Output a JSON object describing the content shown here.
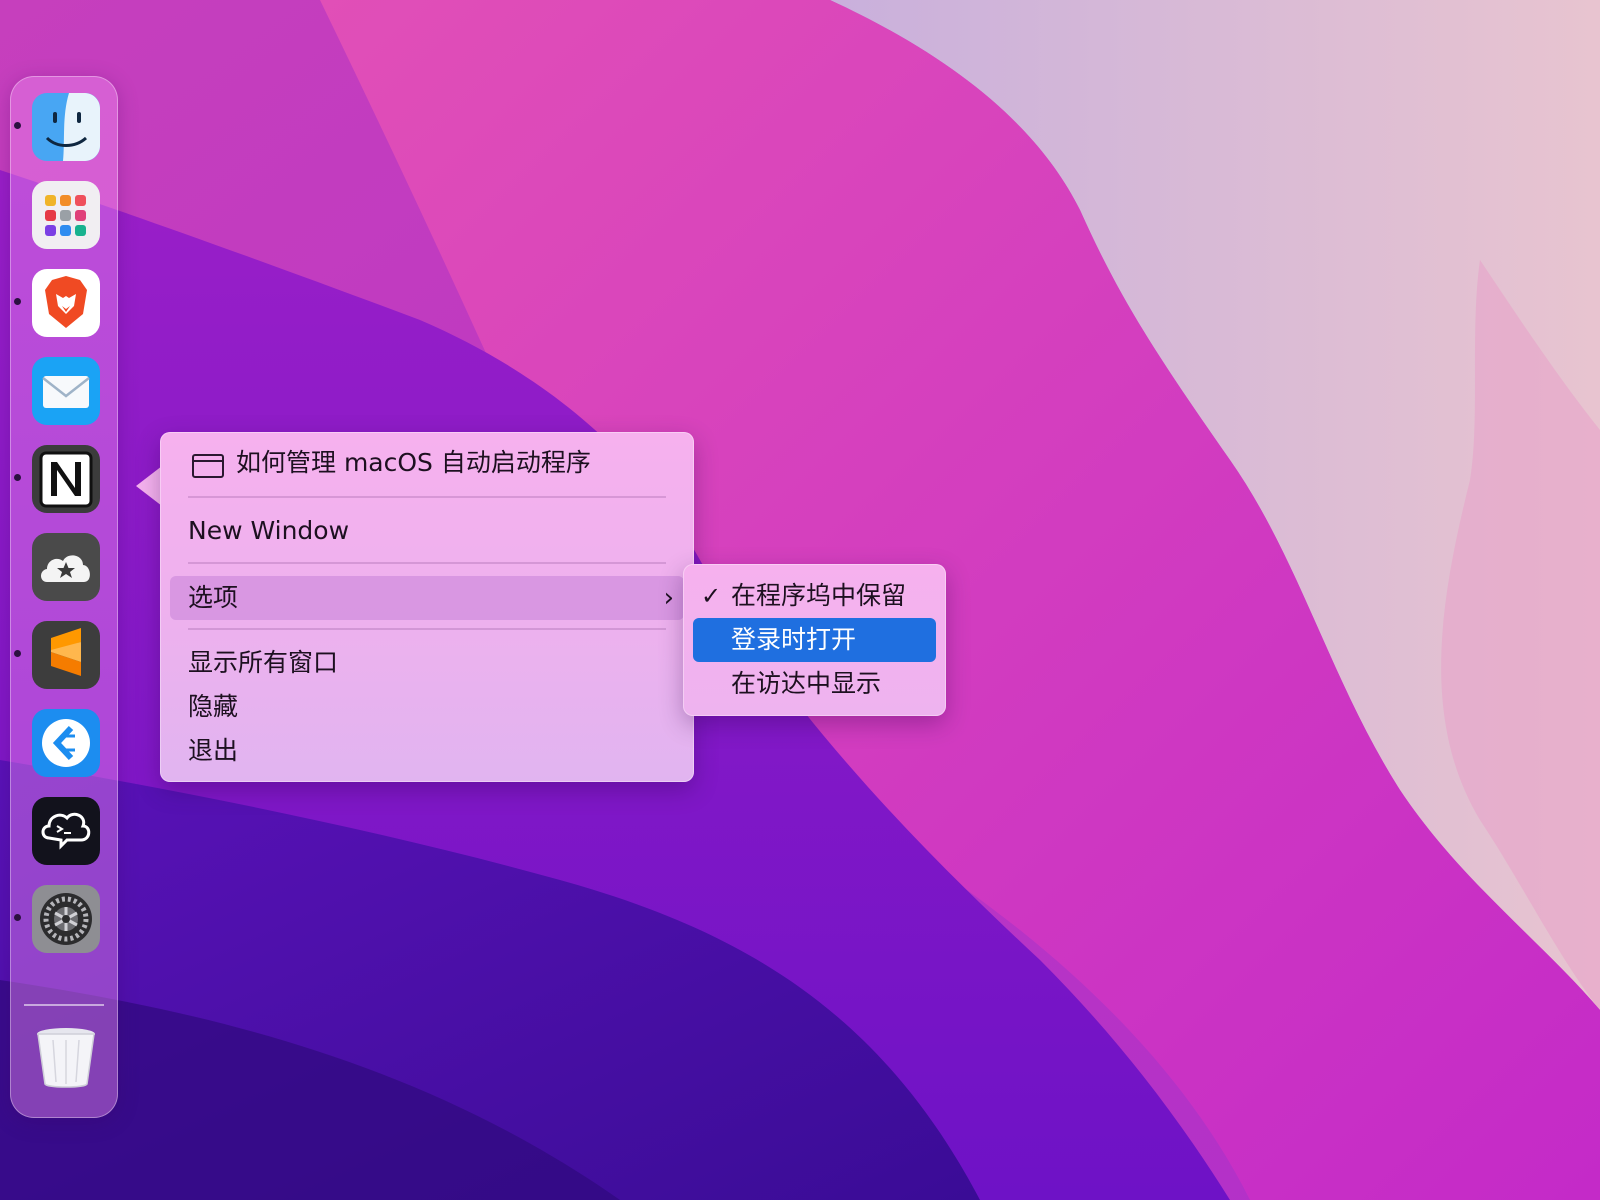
{
  "dock": {
    "apps": [
      {
        "name": "finder",
        "running": true
      },
      {
        "name": "launchpad",
        "running": false
      },
      {
        "name": "brave-browser",
        "running": true
      },
      {
        "name": "mail",
        "running": false
      },
      {
        "name": "notion",
        "running": true
      },
      {
        "name": "reeder",
        "running": false
      },
      {
        "name": "sublime-text",
        "running": true
      },
      {
        "name": "teamviewer",
        "running": false
      },
      {
        "name": "warp-terminal",
        "running": false
      },
      {
        "name": "system-preferences",
        "running": true
      },
      {
        "name": "trash",
        "running": false
      }
    ]
  },
  "context_menu": {
    "window_title": "如何管理 macOS 自动启动程序",
    "new_window": "New Window",
    "options": "选项",
    "options_chevron": "›",
    "show_all_windows": "显示所有窗口",
    "hide": "隐藏",
    "quit": "退出"
  },
  "submenu": {
    "keep_in_dock": "在程序坞中保留",
    "keep_in_dock_check": "✓",
    "open_at_login": "登录时打开",
    "show_in_finder": "在访达中显示"
  },
  "colors": {
    "selection": "#1f6fe0",
    "menu_background": "#f6b1ee"
  }
}
